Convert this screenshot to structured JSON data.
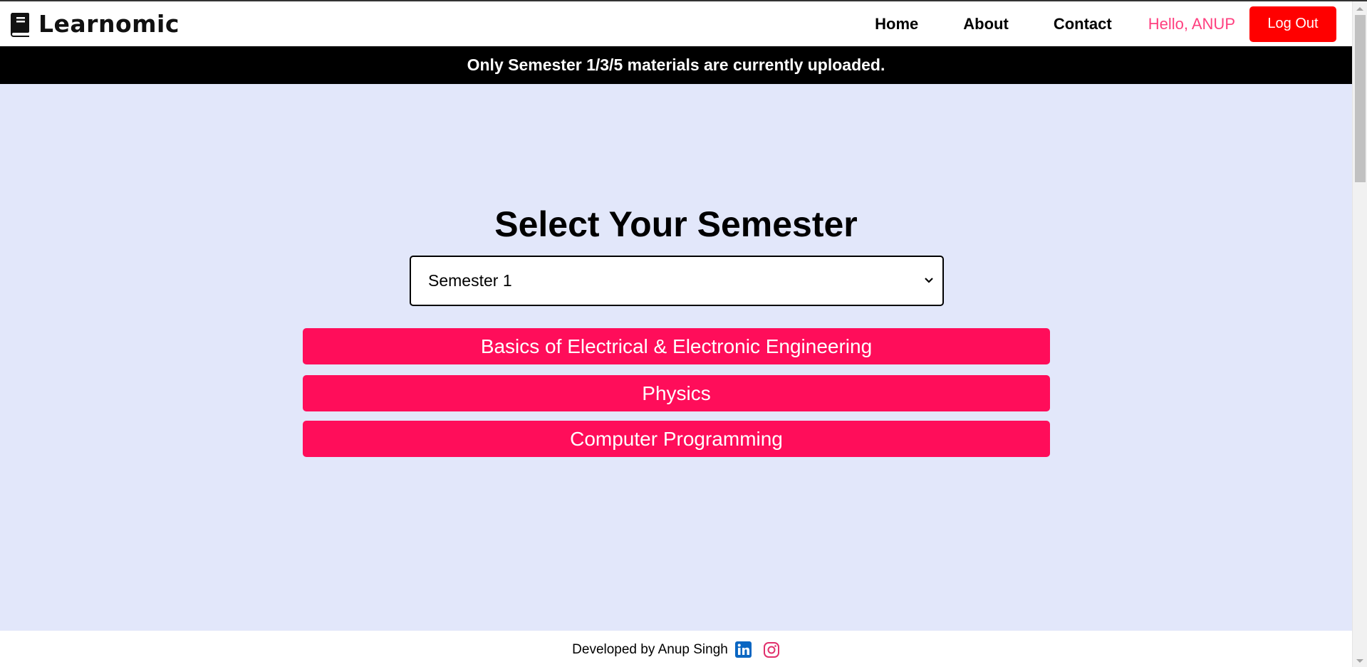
{
  "navbar": {
    "brand": "Learnomic",
    "links": [
      "Home",
      "About",
      "Contact"
    ],
    "greeting": "Hello, ANUP",
    "logout_label": "Log Out"
  },
  "notice": "Only Semester 1/3/5 materials are currently uploaded.",
  "main": {
    "heading": "Select Your Semester",
    "semester_select": {
      "selected": "Semester 1"
    },
    "subjects": [
      "Basics of Electrical & Electronic Engineering",
      "Physics",
      "Computer Programming"
    ]
  },
  "footer": {
    "text": "Developed by Anup Singh",
    "icons": [
      "linkedin-icon",
      "instagram-icon"
    ]
  },
  "colors": {
    "accent": "#ff0d5a",
    "logout": "#ff0000",
    "greeting": "#ff3f7f",
    "main_bg": "#e2e7fa",
    "linkedin": "#0a66c2",
    "instagram": "#e1306c"
  }
}
